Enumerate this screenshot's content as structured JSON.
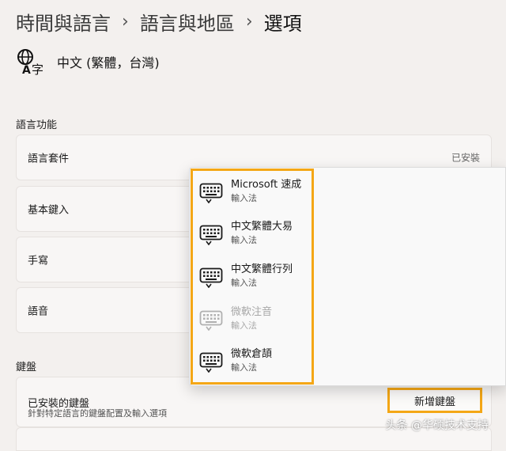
{
  "breadcrumb": {
    "items": [
      "時間與語言",
      "語言與地區",
      "選項"
    ],
    "separator": "›"
  },
  "language": {
    "name": "中文 (繁體，台灣)",
    "icon": "language-icon"
  },
  "language_features": {
    "title": "語言功能",
    "rows": [
      {
        "label": "語言套件",
        "value": "已安裝"
      },
      {
        "label": "基本鍵入",
        "value": ""
      },
      {
        "label": "手寫",
        "value": ""
      },
      {
        "label": "語音",
        "value": ""
      }
    ]
  },
  "keyboards": {
    "title": "鍵盤",
    "installed_label": "已安裝的鍵盤",
    "installed_sub": "針對特定語言的鍵盤配置及輸入選項",
    "add_button": "新增鍵盤"
  },
  "ime_flyout": {
    "items": [
      {
        "name": "Microsoft 速成",
        "type": "輸入法",
        "enabled": true,
        "icon": "keyboard-icon"
      },
      {
        "name": "中文繁體大易",
        "type": "輸入法",
        "enabled": true,
        "icon": "keyboard-icon"
      },
      {
        "name": "中文繁體行列",
        "type": "輸入法",
        "enabled": true,
        "icon": "keyboard-icon"
      },
      {
        "name": "微軟注音",
        "type": "輸入法",
        "enabled": false,
        "icon": "keyboard-icon"
      },
      {
        "name": "微軟倉頡",
        "type": "輸入法",
        "enabled": true,
        "icon": "keyboard-icon"
      }
    ]
  },
  "watermark": "头条 @华硕技术支持",
  "colors": {
    "highlight": "#f4a716",
    "background": "#f3f0ee"
  }
}
